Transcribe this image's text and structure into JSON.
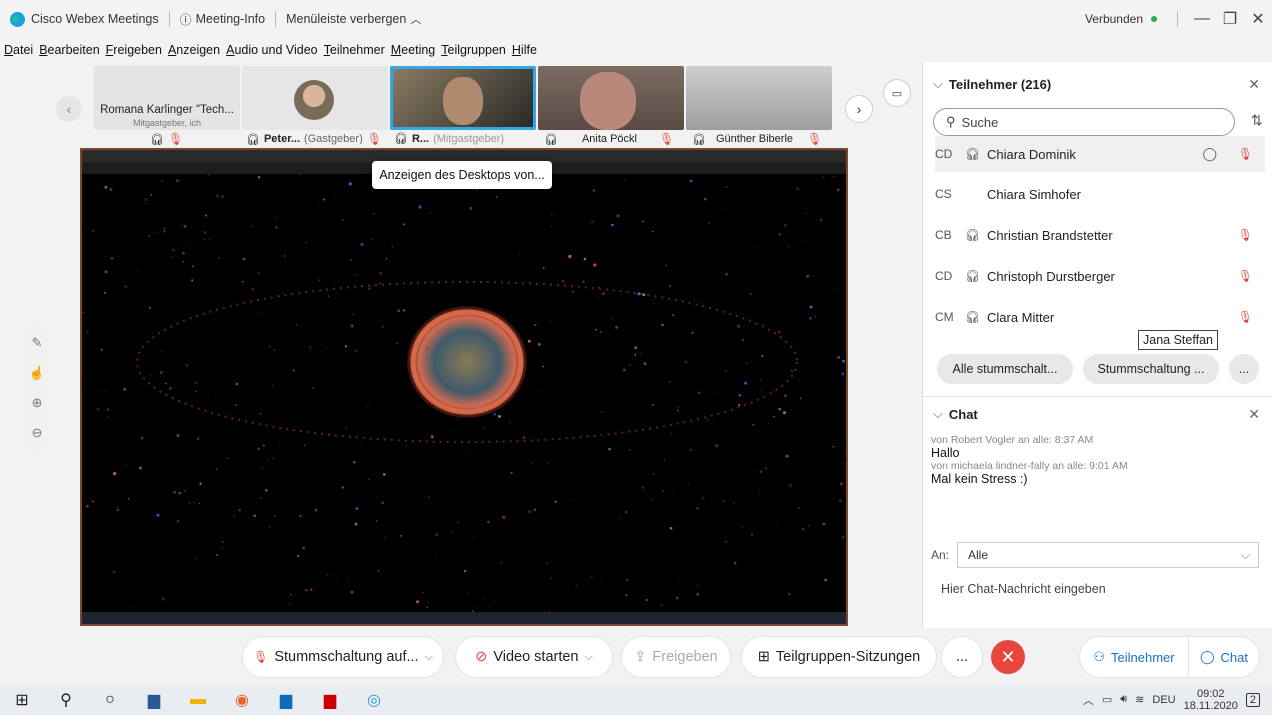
{
  "titlebar": {
    "app_title": "Cisco Webex Meetings",
    "meeting_info": "Meeting-Info",
    "hide_menu": "Menüleiste verbergen",
    "status": "Verbunden"
  },
  "menu": [
    "Datei",
    "Bearbeiten",
    "Freigeben",
    "Anzeigen",
    "Audio und Video",
    "Teilnehmer",
    "Meeting",
    "Teilgruppen",
    "Hilfe"
  ],
  "video_strip": {
    "first_name": "Romana Karlinger \"Tech...",
    "first_sub": "Mitgastgeber, ich",
    "tiles": [
      {
        "name": "Peter...",
        "role": "(Gastgeber)"
      },
      {
        "name": "R...",
        "role": "(Mitgastgeber)"
      },
      {
        "name": "Anita Pöckl",
        "role": ""
      },
      {
        "name": "Günther Biberle",
        "role": ""
      }
    ]
  },
  "share": {
    "tooltip": "Anzeigen des Desktops von..."
  },
  "participants": {
    "header": "Teilnehmer (216)",
    "search_placeholder": "Suche",
    "list": [
      {
        "initials": "CD",
        "name": "Chiara Dominik",
        "audio": true,
        "muted": true
      },
      {
        "initials": "CS",
        "name": "Chiara Simhofer",
        "audio": false,
        "muted": false
      },
      {
        "initials": "CB",
        "name": "Christian Brandstetter",
        "audio": true,
        "muted": true
      },
      {
        "initials": "CD",
        "name": "Christoph Durstberger",
        "audio": true,
        "muted": true
      },
      {
        "initials": "CM",
        "name": "Clara Mitter",
        "audio": true,
        "muted": true
      }
    ],
    "hover_tooltip": "Jana Steffan",
    "mute_all": "Alle stummschalt...",
    "mute": "Stummschaltung ...",
    "more": "..."
  },
  "chat": {
    "header": "Chat",
    "messages": [
      {
        "meta": "von Robert Vogler an alle:   8:37 AM",
        "text": "Hallo"
      },
      {
        "meta": "von michaela lindner-fally an alle:   9:01 AM",
        "text": "Mal kein Stress :)"
      }
    ],
    "to_label": "An:",
    "to_value": "Alle",
    "input_placeholder": "Hier Chat-Nachricht eingeben"
  },
  "controls": {
    "mute": "Stummschaltung auf...",
    "video": "Video starten",
    "share": "Freigeben",
    "breakout": "Teilgruppen-Sitzungen",
    "more": "...",
    "participants": "Teilnehmer",
    "chat": "Chat"
  },
  "taskbar": {
    "lang": "DEU",
    "time": "09:02",
    "date": "18.11.2020",
    "notif": "2"
  },
  "colors": {
    "accent": "#1a73c9",
    "mute_red": "#e0473e",
    "leave_red": "#e8453c",
    "connected_green": "#22b14c"
  }
}
